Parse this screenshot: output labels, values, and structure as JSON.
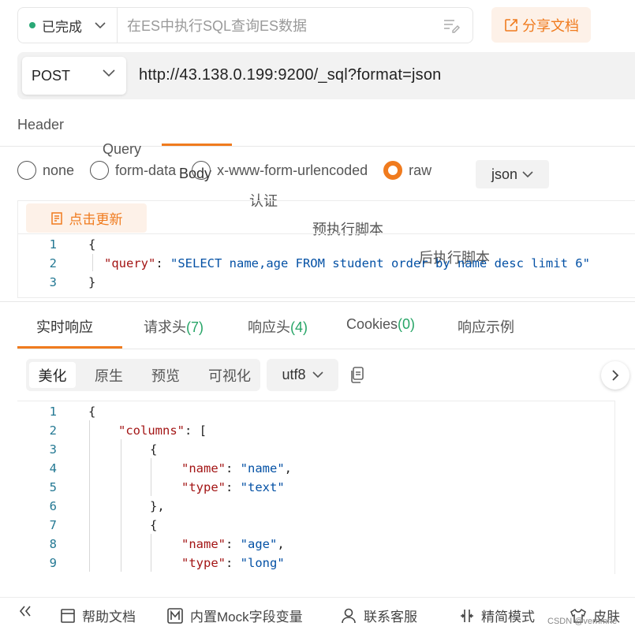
{
  "toolbar": {
    "status": "已完成",
    "api_name_placeholder": "在ES中执行SQL查询ES数据",
    "share_label": "分享文档"
  },
  "request": {
    "method": "POST",
    "url": "http://43.138.0.199:9200/_sql?format=json",
    "tabs": [
      "Header",
      "Query",
      "Body",
      "认证",
      "预执行脚本",
      "后执行脚本"
    ],
    "active_tab": "Body",
    "body_types": [
      "none",
      "form-data",
      "x-www-form-urlencoded",
      "raw"
    ],
    "selected_body_type": "raw",
    "raw_format": "json",
    "update_label": "点击更新",
    "body_lines": [
      {
        "n": "1",
        "text": "{"
      },
      {
        "n": "2",
        "key": "\"query\"",
        "value": "\"SELECT name,age FROM student order by name desc limit 6\""
      },
      {
        "n": "3",
        "text": "}"
      }
    ]
  },
  "response": {
    "tabs": [
      {
        "label": "实时响应",
        "count": ""
      },
      {
        "label": "请求头",
        "count": "(7)"
      },
      {
        "label": "响应头",
        "count": "(4)"
      },
      {
        "label": "Cookies",
        "count": "(0)"
      },
      {
        "label": "响应示例",
        "count": ""
      }
    ],
    "active_tab": "实时响应",
    "view_modes": [
      "美化",
      "原生",
      "预览",
      "可视化"
    ],
    "active_view_mode": "美化",
    "encoding": "utf8",
    "lines": [
      {
        "n": "1",
        "p1": "{"
      },
      {
        "n": "2",
        "k": "\"columns\"",
        "p1": ": ["
      },
      {
        "n": "3",
        "p1": "{"
      },
      {
        "n": "4",
        "k": "\"name\"",
        "p1": ": ",
        "v": "\"name\"",
        "p2": ","
      },
      {
        "n": "5",
        "k": "\"type\"",
        "p1": ": ",
        "v": "\"text\"",
        "p2": ""
      },
      {
        "n": "6",
        "p1": "},"
      },
      {
        "n": "7",
        "p1": "{"
      },
      {
        "n": "8",
        "k": "\"name\"",
        "p1": ": ",
        "v": "\"age\"",
        "p2": ","
      },
      {
        "n": "9",
        "k": "\"type\"",
        "p1": ": ",
        "v": "\"long\"",
        "p2": ""
      }
    ]
  },
  "footer": {
    "help": "帮助文档",
    "mock": "内置Mock字段变量",
    "service": "联系客服",
    "simple_mode": "精简模式",
    "skin": "皮肤",
    "watermark": "CSDN @vernmne"
  },
  "colors": {
    "accent": "#f07b1e",
    "success": "#27a567",
    "json_key": "#a31515",
    "json_string": "#0451a5"
  }
}
